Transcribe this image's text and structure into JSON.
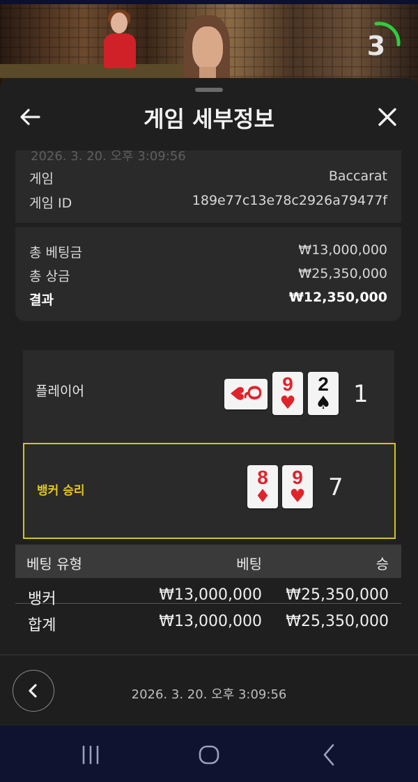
{
  "video": {
    "countdown": "3",
    "accent_color": "#2ecc40"
  },
  "sheet": {
    "title": "게임 세부정보",
    "back_icon": "arrow-left-icon",
    "close_icon": "close-icon"
  },
  "info": {
    "timestamp": "2026. 3. 20. 오후 3:09:56",
    "game_label": "게임",
    "game_value": "Baccarat",
    "game_id_label": "게임 ID",
    "game_id_value": "189e77c13e78c2926a79477f"
  },
  "totals": {
    "total_bet_label": "총 베팅금",
    "total_bet_value": "₩13,000,000",
    "total_win_label": "총 상금",
    "total_win_value": "₩25,350,000",
    "result_label": "결과",
    "result_value": "₩12,350,000"
  },
  "hands": {
    "player": {
      "label": "플레이어",
      "score": "1",
      "cards": [
        {
          "rank": "Q",
          "suit": "♥",
          "color": "red",
          "rotated": true
        },
        {
          "rank": "9",
          "suit": "♥",
          "color": "red"
        },
        {
          "rank": "2",
          "suit": "♠",
          "color": "black"
        }
      ]
    },
    "banker": {
      "label": "뱅커 승리",
      "score": "7",
      "highlight_color": "#d9c21b",
      "cards": [
        {
          "rank": "8",
          "suit": "♦",
          "color": "red"
        },
        {
          "rank": "9",
          "suit": "♥",
          "color": "red"
        }
      ]
    }
  },
  "bet_table": {
    "columns": [
      "베팅 유형",
      "베팅",
      "승"
    ],
    "rows": [
      {
        "type": "뱅커",
        "bet": "₩13,000,000",
        "win": "₩25,350,000"
      },
      {
        "type": "합계",
        "bet": "₩13,000,000",
        "win": "₩25,350,000"
      }
    ]
  },
  "footer": {
    "timestamp": "2026. 3. 20. 오후 3:09:56",
    "prev_icon": "chevron-left-icon"
  },
  "navbar": {
    "recents_icon": "recents-icon",
    "home_icon": "home-icon",
    "back_icon": "back-icon"
  }
}
